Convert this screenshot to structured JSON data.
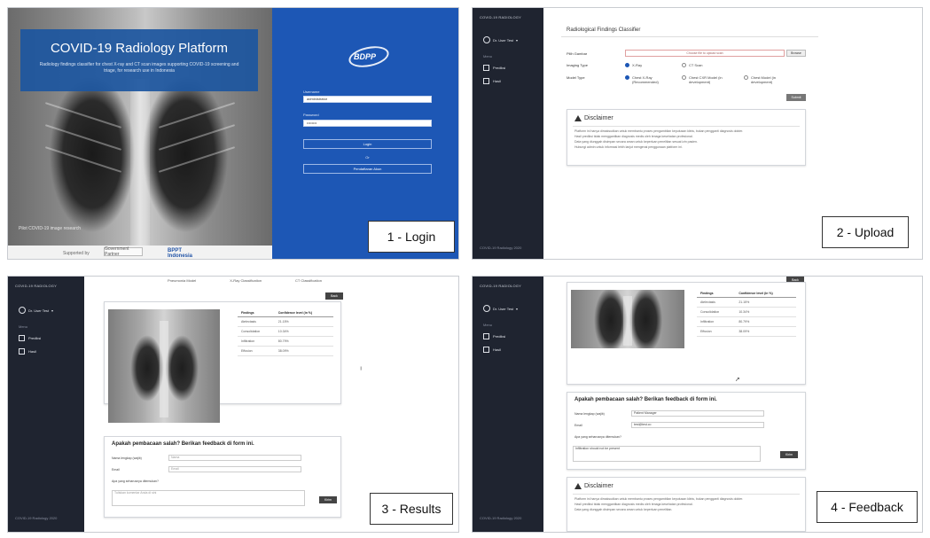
{
  "panel_login": {
    "title": "COVID-19 Radiology Platform",
    "subtitle": "Radiology findings classifier for chest X-ray and CT scan images supporting COVID-19 screening and triage, for research use in Indonesia",
    "logo": "BDPP",
    "username_label": "Username",
    "username_value": "administrator",
    "password_label": "Password",
    "password_value": "••••••••",
    "login_button": "Login",
    "or_text": "Or",
    "register_button": "Pendaftaran Akun",
    "xray_note": "Pilot COVID-19 image research",
    "footer_supported": "Supported by",
    "footer_logo_a": "Government Partner",
    "footer_logo_b": "BPPT Indonesia",
    "step_label": "1 - Login"
  },
  "panel_upload": {
    "brand": "COVID-19 RADIOLOGY",
    "user": "Dr. User Test",
    "menu_label": "Menu",
    "nav": [
      "Prediksi",
      "Hasil"
    ],
    "footer": "COVID-19 Radiology 2020",
    "page_title": "Radiological Findings Classifier",
    "file_label": "Pilih Gambar",
    "file_placeholder": "Choose file to upload scan",
    "browse_button": "Browse",
    "imaging_label": "Imaging Type",
    "imaging_options": [
      "X-Ray",
      "CT Scan"
    ],
    "model_label": "Model Type",
    "model_options": [
      "Chest X-Ray (Recommended)",
      "Chest CXR Model (in development)",
      "Chest Model (in development)"
    ],
    "submit_button": "Submit",
    "disclaimer_title": "Disclaimer",
    "disclaimer_lines": [
      "Platform ini hanya dimaksudkan untuk membantu proses pengambilan keputusan klinis, bukan pengganti diagnosis dokter.",
      "Hasil prediksi tidak menggantikan diagnosis medis oleh tenaga kesehatan profesional.",
      "Data yang diunggah disimpan secara aman untuk keperluan penelitian sesuai izin pasien.",
      "Hubungi admin untuk informasi lebih lanjut mengenai penggunaan platform ini."
    ],
    "step_label": "2 - Upload"
  },
  "panel_results": {
    "brand": "COVID-19 RADIOLOGY",
    "user": "Dr. User Test",
    "menu_label": "Menu",
    "nav": [
      "Prediksi",
      "Hasil"
    ],
    "footer": "COVID-19 Radiology 2020",
    "tabs": [
      "Pneumonia Model",
      "X-Ray Classification",
      "CT Classification"
    ],
    "back_button": "Back",
    "table_headers": [
      "Findings",
      "Confidence level (in %)"
    ],
    "table_rows": [
      [
        "Atelectasis",
        "21.15%"
      ],
      [
        "Consolidation",
        "10.34%"
      ],
      [
        "Infiltration",
        "80.79%"
      ],
      [
        "Effusion",
        "38.09%"
      ]
    ],
    "feedback_title": "Apakah pembacaan salah? Berikan feedback di form ini.",
    "feedback_fields": [
      "Nama lengkap (wajib)",
      "Email",
      "Apa yang seharusnya ditemukan?"
    ],
    "feedback_placeholders": [
      "Nama",
      "Email",
      "Tuliskan komentar Anda di sini"
    ],
    "send_button": "Kirim",
    "step_label": "3 - Results"
  },
  "panel_feedback": {
    "brand": "COVID-19 RADIOLOGY",
    "user": "Dr. User Test",
    "menu_label": "Menu",
    "nav": [
      "Prediksi",
      "Hasil"
    ],
    "footer": "COVID-19 Radiology 2020",
    "back_button": "Back",
    "table_headers": [
      "Findings",
      "Confidence level (in %)"
    ],
    "table_rows": [
      [
        "Atelectasis",
        "21.15%"
      ],
      [
        "Consolidation",
        "10.34%"
      ],
      [
        "Infiltration",
        "80.79%"
      ],
      [
        "Effusion",
        "38.09%"
      ]
    ],
    "feedback_title": "Apakah pembacaan salah? Berikan feedback di form ini.",
    "feedback_fields": [
      "Nama lengkap (wajib)",
      "Email",
      "Apa yang seharusnya ditemukan?"
    ],
    "feedback_values": [
      "Patient Manager",
      "test@test.co",
      "Infiltration should not be present"
    ],
    "send_button": "Kirim",
    "disclaimer_title": "Disclaimer",
    "disclaimer_lines": [
      "Platform ini hanya dimaksudkan untuk membantu proses pengambilan keputusan klinis, bukan pengganti diagnosis dokter.",
      "Hasil prediksi tidak menggantikan diagnosis medis oleh tenaga kesehatan profesional.",
      "Data yang diunggah disimpan secara aman untuk keperluan penelitian."
    ],
    "step_label": "4 - Feedback"
  }
}
